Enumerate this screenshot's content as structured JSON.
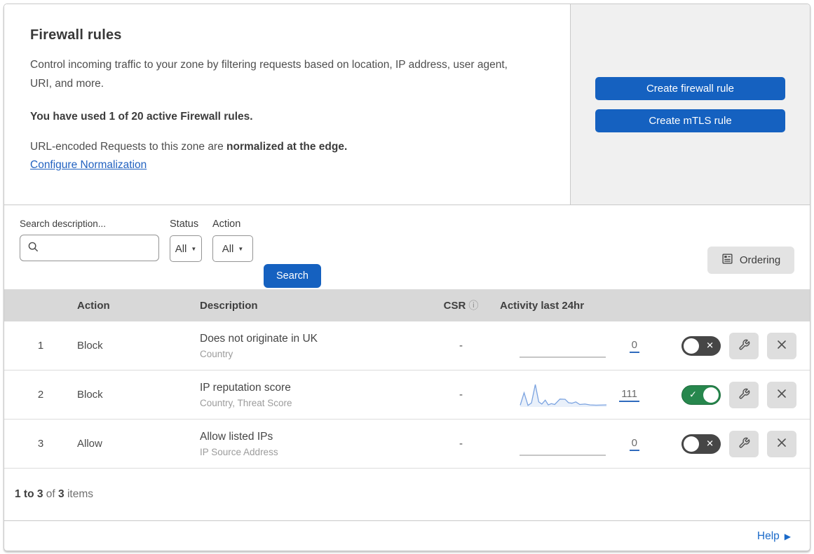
{
  "colors": {
    "accent_blue": "#1561c0",
    "link_blue": "#2262c0",
    "toggle_on_green": "#27874d",
    "toggle_off_gray": "#464646",
    "sparkline_stroke": "#7ba3e0",
    "sparkline_fill": "#e9f0fa",
    "table_header_bg": "#d8d8d8",
    "panel_bg": "#f0f0f0"
  },
  "icons": {
    "dropdown": "▼",
    "info": "ⓘ",
    "check": "✓",
    "cross": "✕",
    "help_arrow": "▶"
  },
  "header": {
    "title": "Firewall rules",
    "description": "Control incoming traffic to your zone by filtering requests based on location, IP address, user agent, URI, and more.",
    "usage": "You have used 1 of 20 active Firewall rules.",
    "normalization_prefix": "URL-encoded Requests to this zone are ",
    "normalization_bold": "normalized at the edge.",
    "normalization_link": "Configure Normalization",
    "create_firewall_button": "Create firewall rule",
    "create_mtls_button": "Create mTLS rule"
  },
  "filters": {
    "search_label": "Search description...",
    "search_value": "",
    "status_label": "Status",
    "status_value": "All",
    "action_label": "Action",
    "action_value": "All",
    "search_button": "Search",
    "ordering_button": "Ordering"
  },
  "table": {
    "columns": {
      "action": "Action",
      "description": "Description",
      "csr": "CSR",
      "activity": "Activity last 24hr"
    },
    "rows": [
      {
        "index": "1",
        "action": "Block",
        "description": "Does not originate in UK",
        "fields": "Country",
        "csr": "-",
        "count": "0",
        "enabled": false,
        "sparkline": null
      },
      {
        "index": "2",
        "action": "Block",
        "description": "IP reputation score",
        "fields": "Country, Threat Score",
        "csr": "-",
        "count": "111",
        "enabled": true,
        "sparkline": [
          [
            0,
            0.05
          ],
          [
            0.045,
            0.62
          ],
          [
            0.09,
            0.04
          ],
          [
            0.13,
            0.15
          ],
          [
            0.175,
            1.0
          ],
          [
            0.215,
            0.2
          ],
          [
            0.25,
            0.1
          ],
          [
            0.29,
            0.28
          ],
          [
            0.325,
            0.06
          ],
          [
            0.36,
            0.12
          ],
          [
            0.4,
            0.08
          ],
          [
            0.46,
            0.33
          ],
          [
            0.52,
            0.32
          ],
          [
            0.56,
            0.16
          ],
          [
            0.6,
            0.14
          ],
          [
            0.645,
            0.2
          ],
          [
            0.69,
            0.08
          ],
          [
            0.75,
            0.1
          ],
          [
            0.81,
            0.06
          ],
          [
            0.88,
            0.05
          ],
          [
            1,
            0.06
          ]
        ]
      },
      {
        "index": "3",
        "action": "Allow",
        "description": "Allow listed IPs",
        "fields": "IP Source Address",
        "csr": "-",
        "count": "0",
        "enabled": false,
        "sparkline": null
      }
    ]
  },
  "footer": {
    "range": "1 to 3",
    "of": " of ",
    "total": "3",
    "items": " items"
  },
  "help": {
    "label": "Help"
  }
}
